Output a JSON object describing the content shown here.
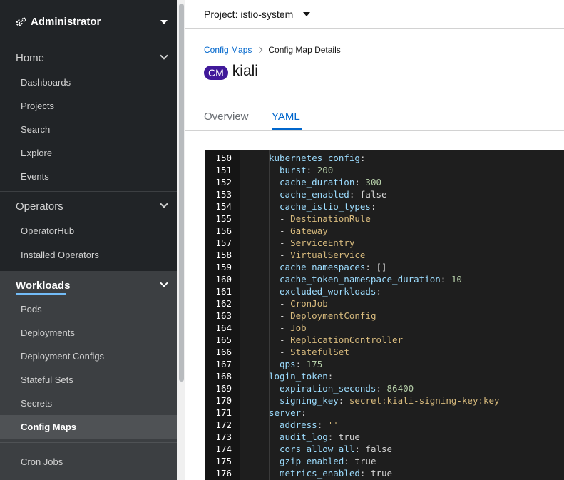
{
  "sidebar": {
    "perspective": "Administrator",
    "sections": [
      {
        "label": "Home",
        "items": [
          "Dashboards",
          "Projects",
          "Search",
          "Explore",
          "Events"
        ]
      },
      {
        "label": "Operators",
        "items": [
          "OperatorHub",
          "Installed Operators"
        ]
      },
      {
        "label": "Workloads",
        "items": [
          "Pods",
          "Deployments",
          "Deployment Configs",
          "Stateful Sets",
          "Secrets",
          "Config Maps",
          "Cron Jobs"
        ]
      }
    ],
    "active_item": "Config Maps"
  },
  "header": {
    "project_label": "Project: istio-system"
  },
  "breadcrumb": {
    "parent": "Config Maps",
    "current": "Config Map Details"
  },
  "resource": {
    "badge": "CM",
    "name": "kiali"
  },
  "tabs": [
    "Overview",
    "YAML"
  ],
  "active_tab": "YAML",
  "editor": {
    "lines": [
      {
        "no": "150",
        "indent": 0,
        "key": "kubernetes_config",
        "sep": ":",
        "value": "",
        "vtype": ""
      },
      {
        "no": "151",
        "indent": 1,
        "key": "burst",
        "sep": ": ",
        "value": "200",
        "vtype": "n"
      },
      {
        "no": "152",
        "indent": 1,
        "key": "cache_duration",
        "sep": ": ",
        "value": "300",
        "vtype": "n"
      },
      {
        "no": "153",
        "indent": 1,
        "key": "cache_enabled",
        "sep": ": ",
        "value": "false",
        "vtype": "p"
      },
      {
        "no": "154",
        "indent": 1,
        "key": "cache_istio_types",
        "sep": ":",
        "value": "",
        "vtype": ""
      },
      {
        "no": "155",
        "indent": 1,
        "key": "",
        "sep": "- ",
        "value": "DestinationRule",
        "vtype": "v"
      },
      {
        "no": "156",
        "indent": 1,
        "key": "",
        "sep": "- ",
        "value": "Gateway",
        "vtype": "v"
      },
      {
        "no": "157",
        "indent": 1,
        "key": "",
        "sep": "- ",
        "value": "ServiceEntry",
        "vtype": "v"
      },
      {
        "no": "158",
        "indent": 1,
        "key": "",
        "sep": "- ",
        "value": "VirtualService",
        "vtype": "v"
      },
      {
        "no": "159",
        "indent": 1,
        "key": "cache_namespaces",
        "sep": ": ",
        "value": "[]",
        "vtype": "p"
      },
      {
        "no": "160",
        "indent": 1,
        "key": "cache_token_namespace_duration",
        "sep": ": ",
        "value": "10",
        "vtype": "n"
      },
      {
        "no": "161",
        "indent": 1,
        "key": "excluded_workloads",
        "sep": ":",
        "value": "",
        "vtype": ""
      },
      {
        "no": "162",
        "indent": 1,
        "key": "",
        "sep": "- ",
        "value": "CronJob",
        "vtype": "v"
      },
      {
        "no": "163",
        "indent": 1,
        "key": "",
        "sep": "- ",
        "value": "DeploymentConfig",
        "vtype": "v"
      },
      {
        "no": "164",
        "indent": 1,
        "key": "",
        "sep": "- ",
        "value": "Job",
        "vtype": "v"
      },
      {
        "no": "165",
        "indent": 1,
        "key": "",
        "sep": "- ",
        "value": "ReplicationController",
        "vtype": "v"
      },
      {
        "no": "166",
        "indent": 1,
        "key": "",
        "sep": "- ",
        "value": "StatefulSet",
        "vtype": "v"
      },
      {
        "no": "167",
        "indent": 1,
        "key": "qps",
        "sep": ": ",
        "value": "175",
        "vtype": "n"
      },
      {
        "no": "168",
        "indent": 0,
        "key": "login_token",
        "sep": ":",
        "value": "",
        "vtype": ""
      },
      {
        "no": "169",
        "indent": 1,
        "key": "expiration_seconds",
        "sep": ": ",
        "value": "86400",
        "vtype": "n"
      },
      {
        "no": "170",
        "indent": 1,
        "key": "signing_key",
        "sep": ": ",
        "value": "secret:kiali-signing-key:key",
        "vtype": "v"
      },
      {
        "no": "171",
        "indent": 0,
        "key": "server",
        "sep": ":",
        "value": "",
        "vtype": ""
      },
      {
        "no": "172",
        "indent": 1,
        "key": "address",
        "sep": ": ",
        "value": "''",
        "vtype": "v"
      },
      {
        "no": "173",
        "indent": 1,
        "key": "audit_log",
        "sep": ": ",
        "value": "true",
        "vtype": "p"
      },
      {
        "no": "174",
        "indent": 1,
        "key": "cors_allow_all",
        "sep": ": ",
        "value": "false",
        "vtype": "p"
      },
      {
        "no": "175",
        "indent": 1,
        "key": "gzip_enabled",
        "sep": ": ",
        "value": "true",
        "vtype": "p"
      },
      {
        "no": "176",
        "indent": 1,
        "key": "metrics_enabled",
        "sep": ": ",
        "value": "true",
        "vtype": "p"
      }
    ]
  },
  "colors": {
    "sidebar_bg": "#212427",
    "active_section_bg": "#3c3f42",
    "link": "#0066cc",
    "badge": "#40199a",
    "editor_bg": "#1e1e1e"
  }
}
